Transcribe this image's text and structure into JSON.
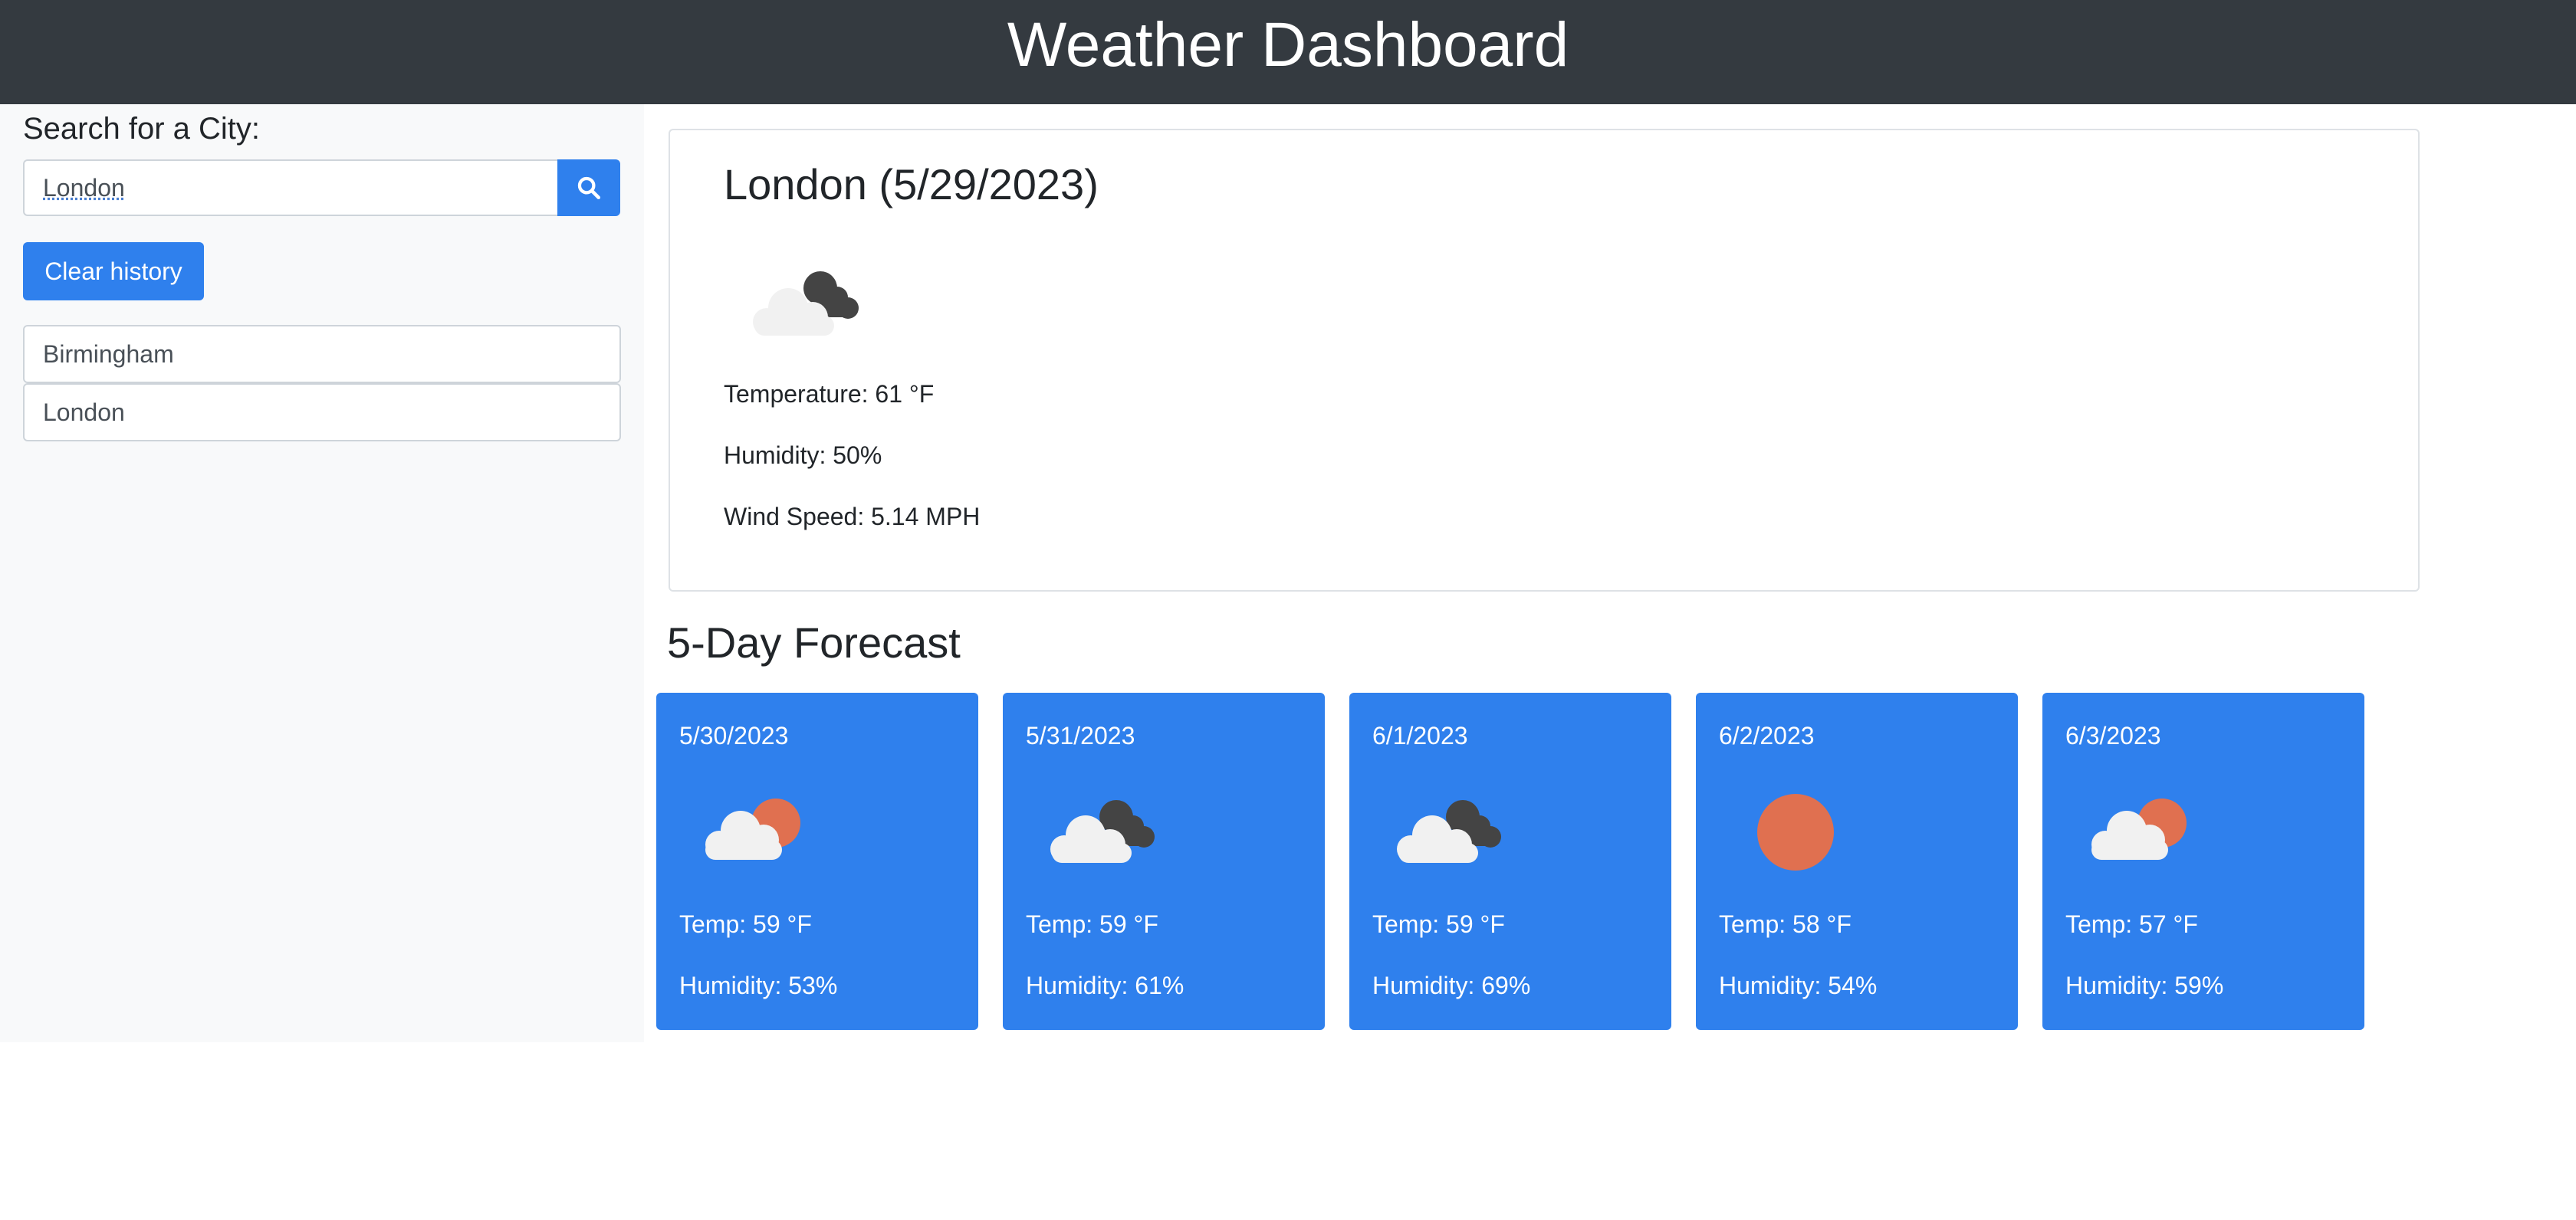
{
  "header": {
    "title": "Weather Dashboard"
  },
  "sidebar": {
    "search_label": "Search for a City:",
    "search_value": "London",
    "clear_label": "Clear history",
    "history": [
      "Birmingham",
      "London"
    ]
  },
  "current": {
    "title": "London (5/29/2023)",
    "icon": "cloud-dark-icon",
    "temperature": "Temperature: 61 °F",
    "humidity": "Humidity: 50%",
    "wind": "Wind Speed: 5.14 MPH"
  },
  "forecast": {
    "title": "5-Day Forecast",
    "days": [
      {
        "date": "5/30/2023",
        "icon": "cloud-sun-icon",
        "temp": "Temp: 59 °F",
        "humidity": "Humidity: 53%"
      },
      {
        "date": "5/31/2023",
        "icon": "cloud-dark-icon",
        "temp": "Temp: 59 °F",
        "humidity": "Humidity: 61%"
      },
      {
        "date": "6/1/2023",
        "icon": "cloud-dark-icon",
        "temp": "Temp: 59 °F",
        "humidity": "Humidity: 69%"
      },
      {
        "date": "6/2/2023",
        "icon": "sun-icon",
        "temp": "Temp: 58 °F",
        "humidity": "Humidity: 54%"
      },
      {
        "date": "6/3/2023",
        "icon": "cloud-sun-icon",
        "temp": "Temp: 57 °F",
        "humidity": "Humidity: 59%"
      }
    ]
  },
  "colors": {
    "header_bg": "#343a40",
    "primary": "#2f80ed",
    "sidebar_bg": "#f8f9fa",
    "sun": "#e07050",
    "cloud_light": "#f1f1f1",
    "cloud_dark": "#444444"
  }
}
